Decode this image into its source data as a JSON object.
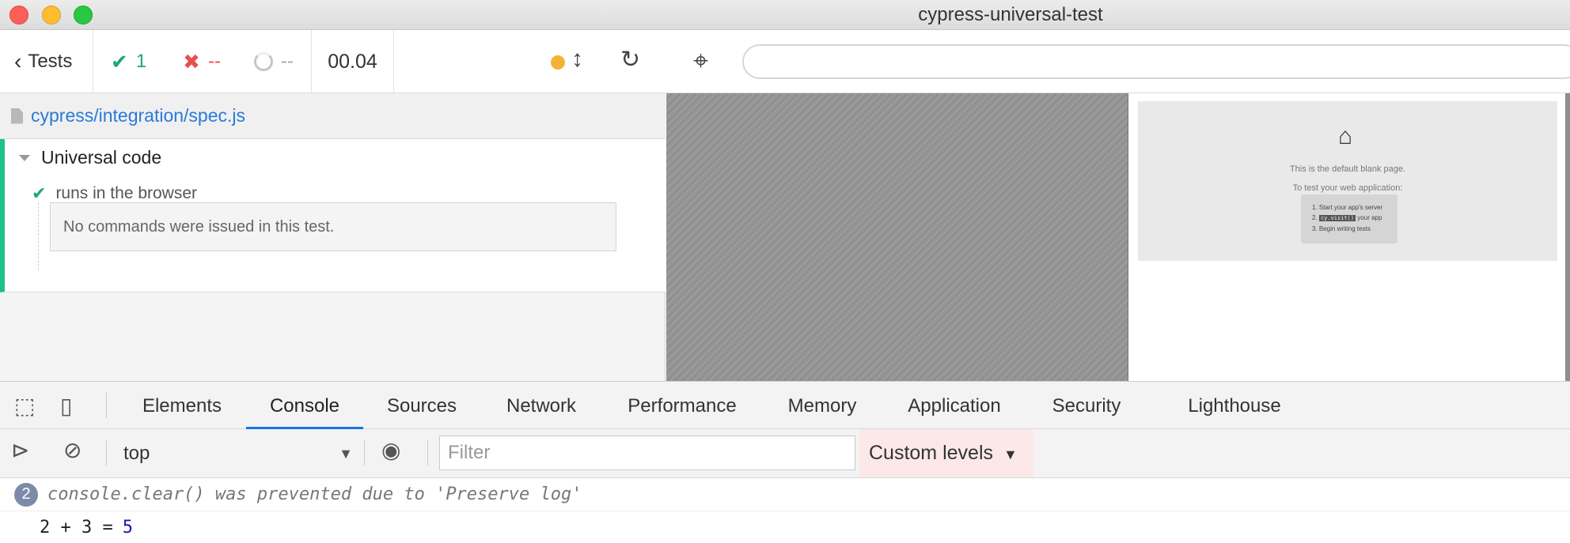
{
  "window": {
    "title": "cypress-universal-test"
  },
  "reporter": {
    "back_label": "Tests",
    "passed": "1",
    "failed": "--",
    "pending": "--",
    "duration": "00.04",
    "spec_path": "cypress/integration/spec.js",
    "suite_title": "Universal code",
    "test_title": "runs in the browser",
    "no_commands": "No commands were issued in this test."
  },
  "aut": {
    "url": "",
    "blank_line1": "This is the default blank page.",
    "blank_line2": "To test your web application:",
    "steps": [
      "1. Start your app's server",
      "2.",
      "cy.visit()",
      "your app",
      "3. Begin writing tests"
    ]
  },
  "devtools": {
    "tabs": [
      "Elements",
      "Console",
      "Sources",
      "Network",
      "Performance",
      "Memory",
      "Application",
      "Security",
      "Lighthouse"
    ],
    "active_tab": "Console",
    "context": "top",
    "filter_placeholder": "Filter",
    "levels_label": "Custom levels",
    "messages": [
      {
        "count": "2",
        "text": "console.clear() was prevented due to 'Preserve log'"
      },
      {
        "expr": "2 + 3 =",
        "result": "5"
      }
    ]
  },
  "colors": {
    "pass": "#1fa971",
    "fail": "#e94f4f",
    "accent": "#1a73e8",
    "running": "#f5b335"
  }
}
